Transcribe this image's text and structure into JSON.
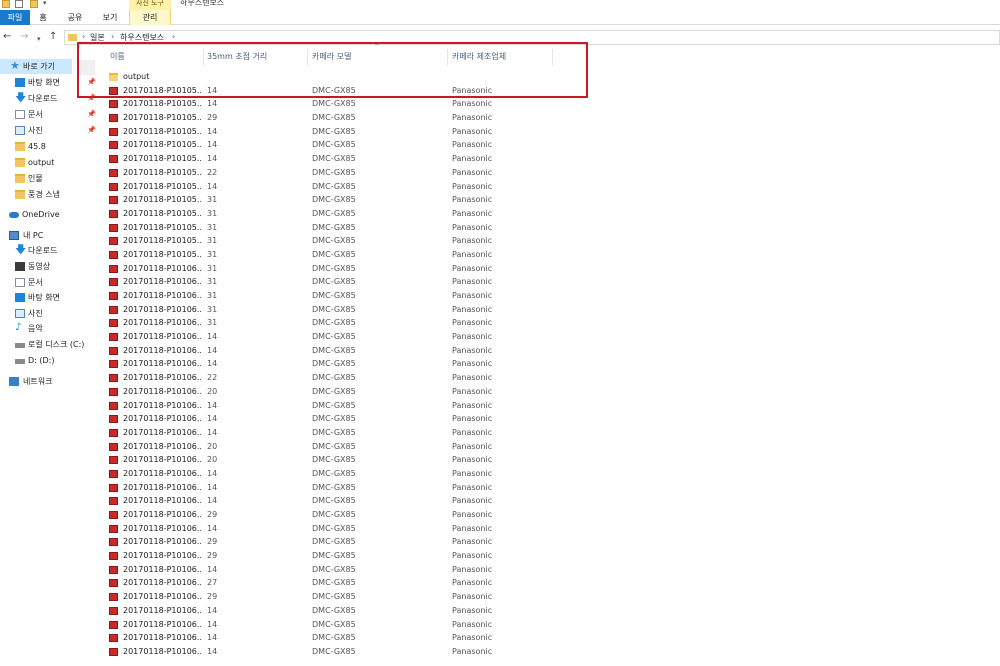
{
  "window": {
    "title": "하우스텐보스",
    "context_tab_top": "사진 도구"
  },
  "ribbon": {
    "tabs": [
      "파일",
      "홈",
      "공유",
      "보기",
      "관리"
    ]
  },
  "address": {
    "crumbs": [
      "일본",
      "하우스텐보스"
    ]
  },
  "sidebar": {
    "items": [
      {
        "label": "바로 가기",
        "icon": "star-icon",
        "pinned": false
      },
      {
        "label": "바탕 화면",
        "icon": "desktop-icon",
        "pinned": true
      },
      {
        "label": "다운로드",
        "icon": "download-icon",
        "pinned": true
      },
      {
        "label": "문서",
        "icon": "document-icon",
        "pinned": true
      },
      {
        "label": "사진",
        "icon": "pictures-icon",
        "pinned": true
      },
      {
        "label": "45.8",
        "icon": "folder-icon",
        "pinned": false
      },
      {
        "label": "output",
        "icon": "folder-icon",
        "pinned": false
      },
      {
        "label": "인물",
        "icon": "folder-icon",
        "pinned": false
      },
      {
        "label": "풍경 스냅",
        "icon": "folder-icon",
        "pinned": false
      },
      {
        "label": "OneDrive",
        "icon": "onedrive-icon",
        "pinned": false
      },
      {
        "label": "내 PC",
        "icon": "pc-icon",
        "pinned": false
      },
      {
        "label": "다운로드",
        "icon": "download-icon",
        "pinned": false
      },
      {
        "label": "동영상",
        "icon": "video-icon",
        "pinned": false
      },
      {
        "label": "문서",
        "icon": "document-icon",
        "pinned": false
      },
      {
        "label": "바탕 화면",
        "icon": "desktop-icon",
        "pinned": false
      },
      {
        "label": "사진",
        "icon": "pictures-icon",
        "pinned": false
      },
      {
        "label": "음악",
        "icon": "music-icon",
        "pinned": false
      },
      {
        "label": "로컬 디스크 (C:)",
        "icon": "disk-icon",
        "pinned": false
      },
      {
        "label": "D: (D:)",
        "icon": "drive-icon",
        "pinned": false
      },
      {
        "label": "네트워크",
        "icon": "network-icon",
        "pinned": false
      }
    ]
  },
  "columns": {
    "name": "이름",
    "focal": "35mm 초점 거리",
    "model": "카메라 모델",
    "maker": "카메라 제조업체"
  },
  "files": [
    {
      "name": "output",
      "type": "folder",
      "focal": "",
      "model": "",
      "maker": ""
    },
    {
      "name": "20170118-P10105...",
      "type": "image",
      "focal": "14",
      "model": "DMC-GX85",
      "maker": "Panasonic"
    },
    {
      "name": "20170118-P10105...",
      "type": "image",
      "focal": "14",
      "model": "DMC-GX85",
      "maker": "Panasonic"
    },
    {
      "name": "20170118-P10105...",
      "type": "image",
      "focal": "29",
      "model": "DMC-GX85",
      "maker": "Panasonic"
    },
    {
      "name": "20170118-P10105...",
      "type": "image",
      "focal": "14",
      "model": "DMC-GX85",
      "maker": "Panasonic"
    },
    {
      "name": "20170118-P10105...",
      "type": "image",
      "focal": "14",
      "model": "DMC-GX85",
      "maker": "Panasonic"
    },
    {
      "name": "20170118-P10105...",
      "type": "image",
      "focal": "14",
      "model": "DMC-GX85",
      "maker": "Panasonic"
    },
    {
      "name": "20170118-P10105...",
      "type": "image",
      "focal": "22",
      "model": "DMC-GX85",
      "maker": "Panasonic"
    },
    {
      "name": "20170118-P10105...",
      "type": "image",
      "focal": "14",
      "model": "DMC-GX85",
      "maker": "Panasonic"
    },
    {
      "name": "20170118-P10105...",
      "type": "image",
      "focal": "31",
      "model": "DMC-GX85",
      "maker": "Panasonic"
    },
    {
      "name": "20170118-P10105...",
      "type": "image",
      "focal": "31",
      "model": "DMC-GX85",
      "maker": "Panasonic"
    },
    {
      "name": "20170118-P10105...",
      "type": "image",
      "focal": "31",
      "model": "DMC-GX85",
      "maker": "Panasonic"
    },
    {
      "name": "20170118-P10105...",
      "type": "image",
      "focal": "31",
      "model": "DMC-GX85",
      "maker": "Panasonic"
    },
    {
      "name": "20170118-P10105...",
      "type": "image",
      "focal": "31",
      "model": "DMC-GX85",
      "maker": "Panasonic"
    },
    {
      "name": "20170118-P10106...",
      "type": "image",
      "focal": "31",
      "model": "DMC-GX85",
      "maker": "Panasonic"
    },
    {
      "name": "20170118-P10106...",
      "type": "image",
      "focal": "31",
      "model": "DMC-GX85",
      "maker": "Panasonic"
    },
    {
      "name": "20170118-P10106...",
      "type": "image",
      "focal": "31",
      "model": "DMC-GX85",
      "maker": "Panasonic"
    },
    {
      "name": "20170118-P10106...",
      "type": "image",
      "focal": "31",
      "model": "DMC-GX85",
      "maker": "Panasonic"
    },
    {
      "name": "20170118-P10106...",
      "type": "image",
      "focal": "31",
      "model": "DMC-GX85",
      "maker": "Panasonic"
    },
    {
      "name": "20170118-P10106...",
      "type": "image",
      "focal": "14",
      "model": "DMC-GX85",
      "maker": "Panasonic"
    },
    {
      "name": "20170118-P10106...",
      "type": "image",
      "focal": "14",
      "model": "DMC-GX85",
      "maker": "Panasonic"
    },
    {
      "name": "20170118-P10106...",
      "type": "image",
      "focal": "14",
      "model": "DMC-GX85",
      "maker": "Panasonic"
    },
    {
      "name": "20170118-P10106...",
      "type": "image",
      "focal": "22",
      "model": "DMC-GX85",
      "maker": "Panasonic"
    },
    {
      "name": "20170118-P10106...",
      "type": "image",
      "focal": "20",
      "model": "DMC-GX85",
      "maker": "Panasonic"
    },
    {
      "name": "20170118-P10106...",
      "type": "image",
      "focal": "14",
      "model": "DMC-GX85",
      "maker": "Panasonic"
    },
    {
      "name": "20170118-P10106...",
      "type": "image",
      "focal": "14",
      "model": "DMC-GX85",
      "maker": "Panasonic"
    },
    {
      "name": "20170118-P10106...",
      "type": "image",
      "focal": "14",
      "model": "DMC-GX85",
      "maker": "Panasonic"
    },
    {
      "name": "20170118-P10106...",
      "type": "image",
      "focal": "20",
      "model": "DMC-GX85",
      "maker": "Panasonic"
    },
    {
      "name": "20170118-P10106...",
      "type": "image",
      "focal": "20",
      "model": "DMC-GX85",
      "maker": "Panasonic"
    },
    {
      "name": "20170118-P10106...",
      "type": "image",
      "focal": "14",
      "model": "DMC-GX85",
      "maker": "Panasonic"
    },
    {
      "name": "20170118-P10106...",
      "type": "image",
      "focal": "14",
      "model": "DMC-GX85",
      "maker": "Panasonic"
    },
    {
      "name": "20170118-P10106...",
      "type": "image",
      "focal": "14",
      "model": "DMC-GX85",
      "maker": "Panasonic"
    },
    {
      "name": "20170118-P10106...",
      "type": "image",
      "focal": "29",
      "model": "DMC-GX85",
      "maker": "Panasonic"
    },
    {
      "name": "20170118-P10106...",
      "type": "image",
      "focal": "14",
      "model": "DMC-GX85",
      "maker": "Panasonic"
    },
    {
      "name": "20170118-P10106...",
      "type": "image",
      "focal": "29",
      "model": "DMC-GX85",
      "maker": "Panasonic"
    },
    {
      "name": "20170118-P10106...",
      "type": "image",
      "focal": "29",
      "model": "DMC-GX85",
      "maker": "Panasonic"
    },
    {
      "name": "20170118-P10106...",
      "type": "image",
      "focal": "14",
      "model": "DMC-GX85",
      "maker": "Panasonic"
    },
    {
      "name": "20170118-P10106...",
      "type": "image",
      "focal": "27",
      "model": "DMC-GX85",
      "maker": "Panasonic"
    },
    {
      "name": "20170118-P10106...",
      "type": "image",
      "focal": "29",
      "model": "DMC-GX85",
      "maker": "Panasonic"
    },
    {
      "name": "20170118-P10106...",
      "type": "image",
      "focal": "14",
      "model": "DMC-GX85",
      "maker": "Panasonic"
    },
    {
      "name": "20170118-P10106...",
      "type": "image",
      "focal": "14",
      "model": "DMC-GX85",
      "maker": "Panasonic"
    },
    {
      "name": "20170118-P10106...",
      "type": "image",
      "focal": "14",
      "model": "DMC-GX85",
      "maker": "Panasonic"
    },
    {
      "name": "20170118-P10106...",
      "type": "image",
      "focal": "14",
      "model": "DMC-GX85",
      "maker": "Panasonic"
    }
  ],
  "colors": {
    "accent": "#1979ca",
    "selection": "#cce8ff",
    "highlight_box": "#c7192a",
    "context_tab": "#fff2a8"
  }
}
